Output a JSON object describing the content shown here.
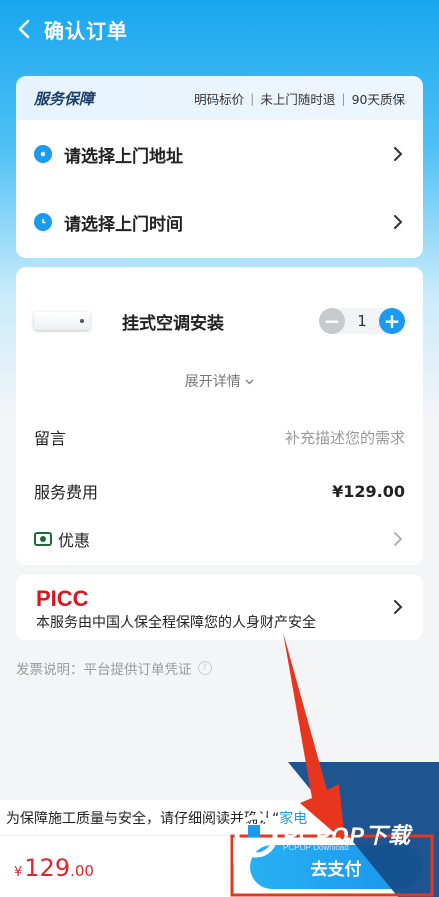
{
  "nav": {
    "title": "确认订单"
  },
  "guarantee": {
    "title": "服务保障",
    "tags": [
      "明码标价",
      "未上门随时退",
      "90天质保"
    ]
  },
  "address": {
    "address_label": "请选择上门地址",
    "time_label": "请选择上门时间"
  },
  "service": {
    "product_name": "挂式空调安装",
    "quantity": "1",
    "expand_label": "展开详情",
    "note_label": "留言",
    "note_placeholder": "补充描述您的需求",
    "fee_label": "服务费用",
    "fee_value": "¥129.00",
    "coupon_label": "优惠"
  },
  "insurance": {
    "logo": "PICC",
    "text": "本服务由中国人保全程保障您的人身财产安全"
  },
  "invoice": {
    "text": "发票说明：平台提供订单凭证"
  },
  "bottom": {
    "agree_text": "为保障施工质量与安全，请仔细阅读并确认“",
    "agree_link": "家电",
    "total_currency": "¥",
    "total_int": "129",
    "total_dec": ".00",
    "pay_label": "去支付"
  },
  "watermark": {
    "text": "PCPOP下载",
    "sub": "PCPOP Download"
  },
  "colors": {
    "accent": "#1a9bf0",
    "price": "#e3242b",
    "annotation": "#e8361e",
    "watermark_bg": "#17508c"
  }
}
